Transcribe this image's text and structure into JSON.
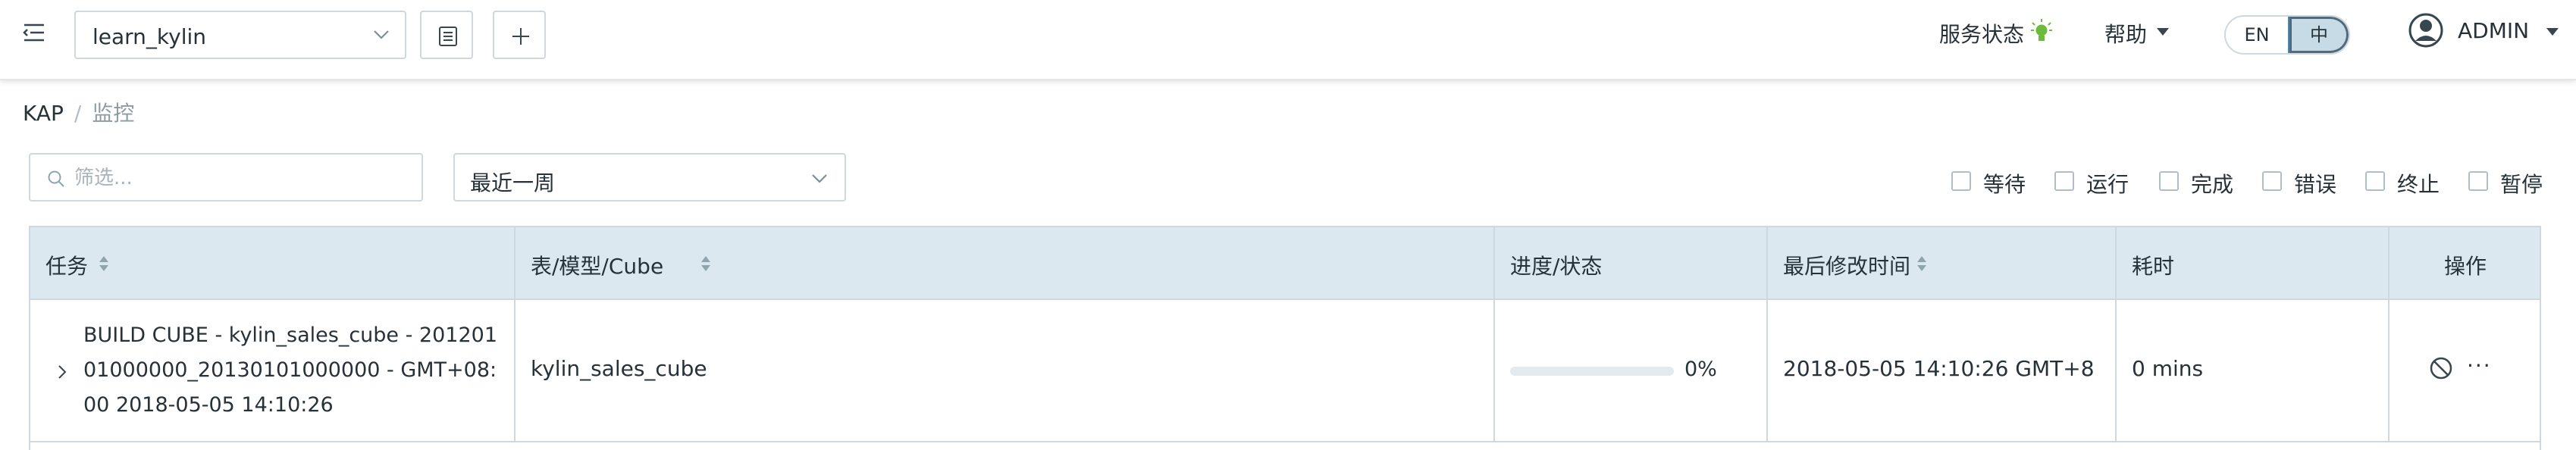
{
  "header": {
    "project": "learn_kylin",
    "service_status": "服务状态",
    "help": "帮助",
    "lang_en": "EN",
    "lang_zh": "中",
    "user": "ADMIN"
  },
  "breadcrumb": {
    "root": "KAP",
    "separator": "/",
    "current": "监控"
  },
  "filters": {
    "search_placeholder": "筛选...",
    "time_range": "最近一周",
    "statuses": [
      "等待",
      "运行",
      "完成",
      "错误",
      "终止",
      "暂停"
    ]
  },
  "table": {
    "columns": [
      "任务",
      "表/模型/Cube",
      "进度/状态",
      "最后修改时间",
      "耗时",
      "操作"
    ],
    "rows": [
      {
        "job": "BUILD CUBE - kylin_sales_cube - 20120101000000_20130101000000 - GMT+08:00 2018-05-05 14:10:26",
        "target": "kylin_sales_cube",
        "progress": 0,
        "progress_label": "0%",
        "last_modified": "2018-05-05 14:10:26 GMT+8",
        "duration": "0 mins"
      }
    ]
  },
  "icons": {
    "menu": "hamburger-icon",
    "list": "list-icon",
    "add": "plus-icon",
    "status": "lightbulb-icon",
    "user": "user-circle-icon",
    "search": "search-icon",
    "expand": "chevron-right-icon",
    "stop": "ban-icon",
    "more": "more-icon"
  },
  "colors": {
    "header_bg": "#dce8f0",
    "service_ok": "#6dbb3c",
    "accent": "#4a87a8",
    "border": "#cfd8dc"
  }
}
